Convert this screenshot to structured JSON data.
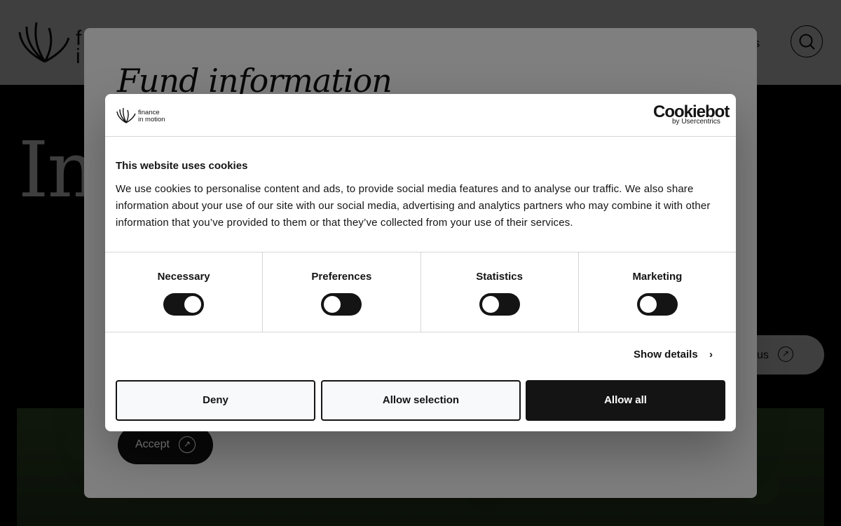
{
  "background": {
    "logo_fragment_1": "f",
    "logo_fragment_2": "i",
    "nav_fragment": "rs",
    "hero_title_fragment": "In",
    "contact_label_fragment": "us",
    "contact_icon": "↗",
    "search_icon": "search-icon"
  },
  "fund_modal": {
    "title": "Fund information",
    "accept_label": "Accept",
    "accept_icon": "↗"
  },
  "cookie_dialog": {
    "logo_text_line1": "finance",
    "logo_text_line2": "in motion",
    "brand": "Cookiebot",
    "brand_sub": "by Usercentrics",
    "title": "This website uses cookies",
    "description": "We use cookies to personalise content and ads, to provide social media features and to analyse our traffic. We also share information about your use of our site with our social media, advertising and analytics partners who may combine it with other information that you’ve provided to them or that they’ve collected from your use of their services.",
    "categories": [
      {
        "label": "Necessary",
        "checked": true
      },
      {
        "label": "Preferences",
        "checked": false
      },
      {
        "label": "Statistics",
        "checked": false
      },
      {
        "label": "Marketing",
        "checked": false
      }
    ],
    "show_details": "Show details",
    "chevron": "›",
    "buttons": {
      "deny": "Deny",
      "allow_selection": "Allow selection",
      "allow_all": "Allow all"
    }
  },
  "colors": {
    "dark": "#141414",
    "overlay": "rgba(0,0,0,0.5)",
    "button_light": "#f8f9fb",
    "divider": "#d6d6d6"
  }
}
